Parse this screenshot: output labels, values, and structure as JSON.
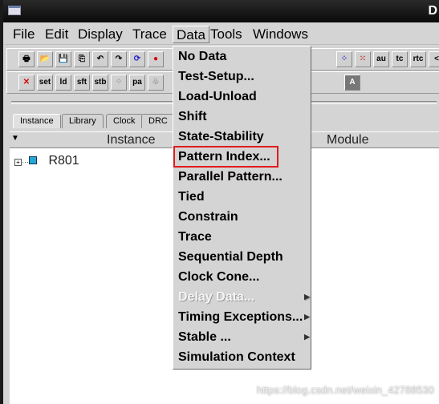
{
  "window": {
    "title": "D"
  },
  "menubar": [
    "File",
    "Edit",
    "Display",
    "Trace",
    "Data",
    "Tools",
    "Windows"
  ],
  "toolbar2": [
    "set",
    "ld",
    "sft",
    "stb",
    "pa"
  ],
  "tabs": [
    "Instance",
    "Library",
    "Clock",
    "DRC"
  ],
  "table": {
    "headers": [
      "Instance",
      "Module"
    ],
    "rows": [
      "R801"
    ]
  },
  "data_menu": {
    "items": [
      {
        "label": "No Data"
      },
      {
        "label": "Test-Setup..."
      },
      {
        "label": "Load-Unload"
      },
      {
        "label": "Shift"
      },
      {
        "label": "State-Stability"
      },
      {
        "label": "Pattern Index..."
      },
      {
        "label": "Parallel Pattern..."
      },
      {
        "label": "Tied"
      },
      {
        "label": "Constrain"
      },
      {
        "label": "Trace"
      },
      {
        "label": "Sequential Depth"
      },
      {
        "label": "Clock Cone..."
      },
      {
        "label": "Delay Data...",
        "disabled": true,
        "submenu": true
      },
      {
        "label": "Timing Exceptions...",
        "submenu": true
      },
      {
        "label": "Stable ...",
        "submenu": true
      },
      {
        "label": "Simulation Context"
      }
    ],
    "highlighted": "Pattern Index...",
    "highlight_color": "#e01b1b"
  },
  "watermark": "https://blog.csdn.net/weixin_42788530"
}
